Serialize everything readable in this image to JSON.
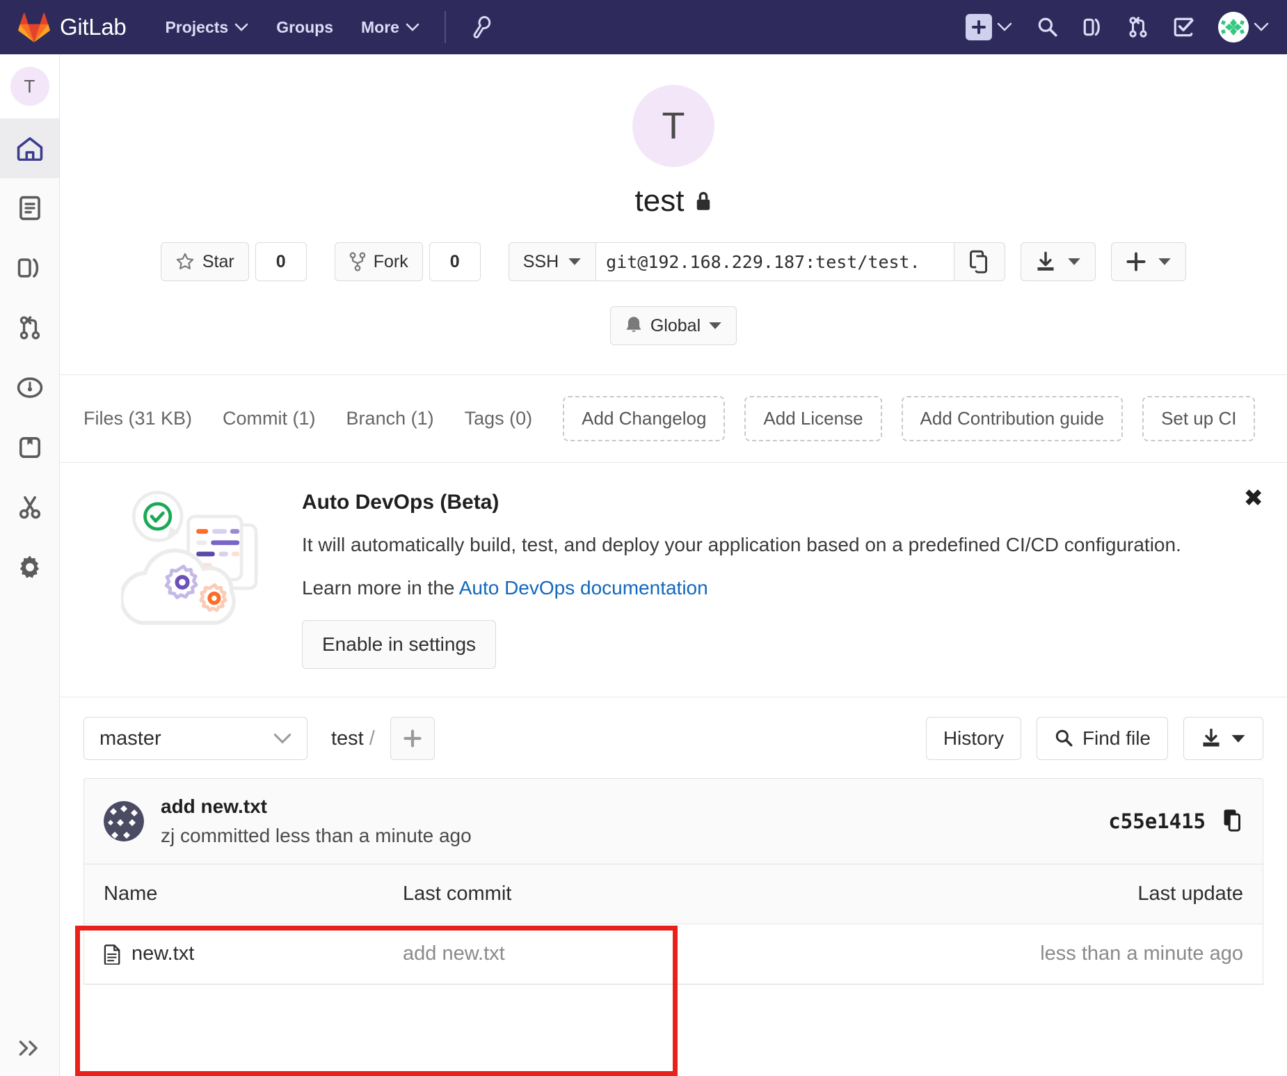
{
  "navbar": {
    "brand": "GitLab",
    "logo_icon": "gitlab-tanuki-icon",
    "links": [
      {
        "label": "Projects",
        "icon": "chevron-down-icon"
      },
      {
        "label": "Groups",
        "icon": ""
      },
      {
        "label": "More",
        "icon": "chevron-down-icon"
      }
    ],
    "admin_icon": "wrench-icon",
    "right_icons": [
      {
        "name": "new-item-plus-icon"
      },
      {
        "name": "search-icon"
      },
      {
        "name": "issues-icon"
      },
      {
        "name": "merge-requests-icon"
      },
      {
        "name": "todos-icon"
      },
      {
        "name": "user-avatar"
      }
    ]
  },
  "sidebar": {
    "avatar_letter": "T",
    "items": [
      {
        "name": "project-overview",
        "icon": "home-icon",
        "active": true
      },
      {
        "name": "repository",
        "icon": "document-icon",
        "active": false
      },
      {
        "name": "issues",
        "icon": "issues-icon",
        "active": false
      },
      {
        "name": "merge-requests",
        "icon": "merge-request-icon",
        "active": false
      },
      {
        "name": "ci-cd",
        "icon": "rocket-gauge-icon",
        "active": false
      },
      {
        "name": "packages",
        "icon": "package-icon",
        "active": false
      },
      {
        "name": "snippets",
        "icon": "scissors-icon",
        "active": false
      },
      {
        "name": "settings",
        "icon": "gear-icon",
        "active": false
      }
    ],
    "collapse_icon": "double-chevron-right-icon"
  },
  "project": {
    "avatar_letter": "T",
    "name": "test",
    "visibility_icon": "lock-icon",
    "star_label": "Star",
    "star_count": "0",
    "fork_label": "Fork",
    "fork_count": "0",
    "clone_protocol": "SSH",
    "clone_url": "git@192.168.229.187:test/test.",
    "copy_icon": "copy-icon",
    "download_icon": "download-icon",
    "add_icon": "plus-icon",
    "notification_label": "Global",
    "notification_icon": "bell-icon"
  },
  "stats": [
    {
      "label": "Files (31 KB)"
    },
    {
      "label": "Commit (1)"
    },
    {
      "label": "Branch (1)"
    },
    {
      "label": "Tags (0)"
    }
  ],
  "quick_actions": [
    {
      "label": "Add Changelog"
    },
    {
      "label": "Add License"
    },
    {
      "label": "Add Contribution guide"
    },
    {
      "label": "Set up CI"
    }
  ],
  "auto_devops": {
    "title": "Auto DevOps (Beta)",
    "description": "It will automatically build, test, and deploy your application based on a predefined CI/CD configuration.",
    "learn_prefix": "Learn more in the ",
    "learn_link": "Auto DevOps documentation",
    "enable_label": "Enable in settings",
    "close_icon": "close-icon",
    "illustration": "cloud-gears-illustration"
  },
  "files_bar": {
    "branch": "master",
    "branch_caret_icon": "chevron-down-icon",
    "breadcrumb_root": "test",
    "breadcrumb_sep": "/",
    "add_file_icon": "plus-icon",
    "history_label": "History",
    "find_file_label": "Find file",
    "find_file_icon": "search-icon",
    "download_icon": "download-icon",
    "download_caret_icon": "caret-down-icon"
  },
  "last_commit": {
    "title": "add new.txt",
    "author_and_time": "zj committed less than a minute ago",
    "sha": "c55e1415",
    "copy_icon": "copy-icon"
  },
  "file_table": {
    "columns": [
      "Name",
      "Last commit",
      "Last update"
    ],
    "rows": [
      {
        "name": "new.txt",
        "icon": "file-text-icon",
        "last_commit": "add new.txt",
        "last_update": "less than a minute ago"
      }
    ]
  },
  "annotation": {
    "color": "#e8211a"
  }
}
